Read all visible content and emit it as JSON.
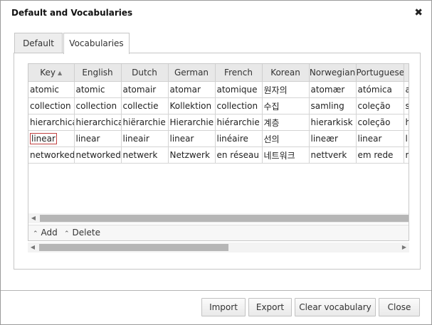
{
  "dialog": {
    "title": "Default and Vocabularies",
    "close_glyph": "✖"
  },
  "tabs": [
    {
      "label": "Default"
    },
    {
      "label": "Vocabularies"
    }
  ],
  "grid": {
    "columns": [
      "Key",
      "English",
      "Dutch",
      "German",
      "French",
      "Korean",
      "Norwegian",
      "Portuguese",
      ""
    ],
    "sort_glyph": "▲",
    "rows": [
      [
        "atomic",
        "atomic",
        "atomair",
        "atomar",
        "atomique",
        "원자의",
        "atomær",
        "atómica",
        "a"
      ],
      [
        "collection",
        "collection",
        "collectie",
        "Kollektion",
        "collection",
        "수집",
        "samling",
        "coleção",
        "s"
      ],
      [
        "hierarchical",
        "hierarchical",
        "hiërarchie",
        "Hierarchie",
        "hiérarchie",
        "계층",
        "hierarkisk",
        "coleção",
        "h"
      ],
      [
        "linear",
        "linear",
        "lineair",
        "linear",
        "linéaire",
        "선의",
        "lineær",
        "linear",
        "l"
      ],
      [
        "networked",
        "networked",
        "netwerk",
        "Netzwerk",
        "en réseau",
        "네트워크",
        "nettverk",
        "em rede",
        "r"
      ]
    ],
    "editing_row": 3
  },
  "toolbar": {
    "add_label": "Add",
    "delete_label": "Delete",
    "caret": "⌃"
  },
  "scroll_glyphs": {
    "left": "◀",
    "right": "▶"
  },
  "buttons": {
    "import": "Import",
    "export": "Export",
    "clear": "Clear vocabulary",
    "close": "Close"
  }
}
